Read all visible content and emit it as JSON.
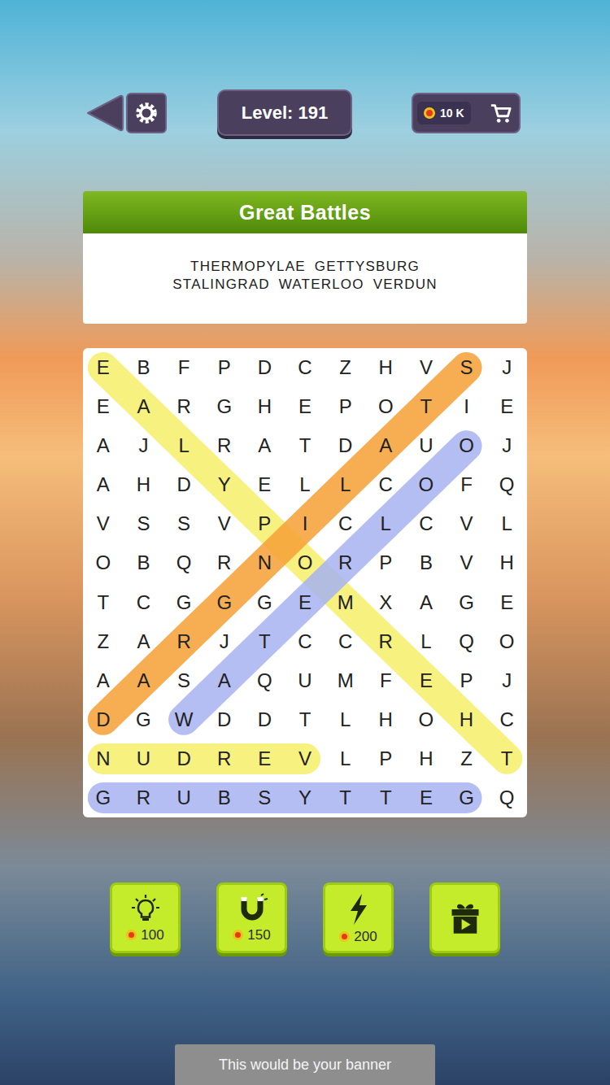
{
  "topbar": {
    "level": "Level: 191",
    "coins": "10 K"
  },
  "puzzle": {
    "title": "Great Battles",
    "word_lines": [
      {
        "words": [
          "THERMOPYLAE",
          "GETTYSBURG"
        ]
      },
      {
        "words": [
          "STALINGRAD",
          "WATERLOO",
          "VERDUN"
        ]
      }
    ]
  },
  "grid": {
    "rows": [
      [
        "E",
        "B",
        "F",
        "P",
        "D",
        "C",
        "Z",
        "H",
        "V",
        "S",
        "J"
      ],
      [
        "E",
        "A",
        "R",
        "G",
        "H",
        "E",
        "P",
        "O",
        "T",
        "I",
        "E"
      ],
      [
        "A",
        "J",
        "L",
        "R",
        "A",
        "T",
        "D",
        "A",
        "U",
        "O",
        "J"
      ],
      [
        "A",
        "H",
        "D",
        "Y",
        "E",
        "L",
        "L",
        "C",
        "O",
        "F",
        "Q"
      ],
      [
        "V",
        "S",
        "S",
        "V",
        "P",
        "I",
        "C",
        "L",
        "C",
        "V",
        "L"
      ],
      [
        "O",
        "B",
        "Q",
        "R",
        "N",
        "O",
        "R",
        "P",
        "B",
        "V",
        "H"
      ],
      [
        "T",
        "C",
        "G",
        "G",
        "G",
        "E",
        "M",
        "X",
        "A",
        "G",
        "E"
      ],
      [
        "Z",
        "A",
        "R",
        "J",
        "T",
        "C",
        "C",
        "R",
        "L",
        "Q",
        "O"
      ],
      [
        "A",
        "A",
        "S",
        "A",
        "Q",
        "U",
        "M",
        "F",
        "E",
        "P",
        "J"
      ],
      [
        "D",
        "G",
        "W",
        "D",
        "D",
        "T",
        "L",
        "H",
        "O",
        "H",
        "C"
      ],
      [
        "N",
        "U",
        "D",
        "R",
        "E",
        "V",
        "L",
        "P",
        "H",
        "Z",
        "T"
      ],
      [
        "G",
        "R",
        "U",
        "B",
        "S",
        "Y",
        "T",
        "T",
        "E",
        "G",
        "Q"
      ]
    ],
    "highlights": [
      {
        "color": "#f6ef6a",
        "start": [
          0,
          0
        ],
        "end": [
          10,
          10
        ]
      },
      {
        "color": "#f6a035",
        "start": [
          0,
          9
        ],
        "end": [
          9,
          0
        ]
      },
      {
        "color": "#a7b3f2",
        "start": [
          2,
          9
        ],
        "end": [
          9,
          2
        ]
      },
      {
        "color": "#f6ef6a",
        "start": [
          10,
          0
        ],
        "end": [
          10,
          5
        ]
      },
      {
        "color": "#a7b3f2",
        "start": [
          11,
          0
        ],
        "end": [
          11,
          9
        ]
      }
    ]
  },
  "powerups": [
    {
      "kind": "hint",
      "price": "100"
    },
    {
      "kind": "magnet",
      "price": "150"
    },
    {
      "kind": "lightning",
      "price": "200"
    },
    {
      "kind": "gift"
    }
  ],
  "banner": {
    "text": "This would be your banner"
  }
}
